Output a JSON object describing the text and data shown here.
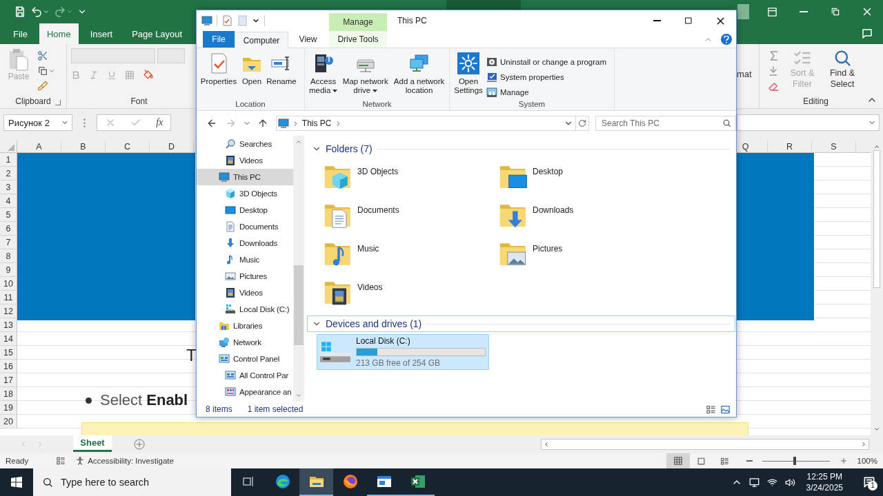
{
  "excel": {
    "tabs": [
      {
        "label": "File",
        "selected": false
      },
      {
        "label": "Home",
        "selected": true
      },
      {
        "label": "Insert",
        "selected": false
      },
      {
        "label": "Page Layout",
        "selected": false
      }
    ],
    "ribbon": {
      "paste": "Paste",
      "clipboard": "Clipboard",
      "font": "Font",
      "format_partial": "mat",
      "sort_filter": "Sort & Filter",
      "find_select": "Find & Select",
      "editing": "Editing"
    },
    "name_box": "Рисунок 2",
    "formula_label": "fx",
    "columns_left": [
      "A",
      "B",
      "C",
      "D"
    ],
    "columns_right": [
      "Q",
      "R",
      "S"
    ],
    "rows": [
      "1",
      "2",
      "3",
      "4",
      "5",
      "6",
      "7",
      "8",
      "9",
      "10",
      "11",
      "12",
      "13",
      "14",
      "15",
      "16",
      "17",
      "18",
      "19",
      "20"
    ],
    "sheet": {
      "heading": "T",
      "bullet": "Select **Enabl**"
    },
    "sheet_tabs": [
      {
        "label": "Sheet",
        "selected": true
      }
    ],
    "status": {
      "ready": "Ready",
      "accessibility": "Accessibility: Investigate",
      "zoom": "100%",
      "level": 0.48
    }
  },
  "explorer": {
    "title": "This PC",
    "context_tab": "Manage",
    "tabs": [
      {
        "label": "File",
        "kind": "file",
        "selected": false
      },
      {
        "label": "Computer",
        "kind": "tab",
        "selected": true
      },
      {
        "label": "View",
        "kind": "tab",
        "selected": false
      },
      {
        "label": "Drive Tools",
        "kind": "context",
        "selected": false
      }
    ],
    "ribbon_groups": [
      {
        "label": "Location",
        "buttons": [
          {
            "label": "Properties",
            "kind": "properties",
            "dropdown": false
          },
          {
            "label": "Open",
            "kind": "open",
            "dropdown": false
          },
          {
            "label": "Rename",
            "kind": "rename",
            "dropdown": false
          }
        ]
      },
      {
        "label": "Network",
        "buttons": [
          {
            "label": "Access media",
            "kind": "media",
            "dropdown": true
          },
          {
            "label": "Map network drive",
            "kind": "netdrive",
            "dropdown": true
          },
          {
            "label": "Add a network location",
            "kind": "netloc",
            "dropdown": false
          }
        ]
      },
      {
        "label": "System",
        "buttons": [
          {
            "label": "Open Settings",
            "kind": "settings",
            "dropdown": false
          }
        ],
        "small_buttons": [
          {
            "label": "Uninstall or change a program",
            "kind": "uninstall"
          },
          {
            "label": "System properties",
            "kind": "sysprops"
          },
          {
            "label": "Manage",
            "kind": "manage"
          }
        ]
      }
    ],
    "address": "This PC",
    "search": {
      "placeholder": "Search This PC"
    },
    "nav": [
      {
        "children": [
          {
            "label": "Searches",
            "kind": "search",
            "selected": false
          },
          {
            "label": "Videos",
            "kind": "video",
            "selected": false
          }
        ]
      },
      {
        "label": "This PC",
        "kind": "pc",
        "selected": true,
        "children": [
          {
            "label": "3D Objects",
            "kind": "cube",
            "selected": false
          },
          {
            "label": "Desktop",
            "kind": "desktop",
            "selected": false
          },
          {
            "label": "Documents",
            "kind": "document",
            "selected": false
          },
          {
            "label": "Downloads",
            "kind": "download",
            "selected": false
          },
          {
            "label": "Music",
            "kind": "music",
            "selected": false
          },
          {
            "label": "Pictures",
            "kind": "picture",
            "selected": false
          },
          {
            "label": "Videos",
            "kind": "video",
            "selected": false
          },
          {
            "label": "Local Disk (C:)",
            "kind": "drive",
            "selected": false
          }
        ]
      },
      {
        "label": "Libraries",
        "kind": "library",
        "selected": false
      },
      {
        "label": "Network",
        "kind": "network",
        "selected": false
      },
      {
        "label": "Control Panel",
        "kind": "control",
        "selected": false,
        "children": [
          {
            "label": "All Control Par",
            "kind": "control",
            "selected": false
          },
          {
            "label": "Appearance an",
            "kind": "appearance",
            "selected": false
          }
        ]
      }
    ],
    "folders_header": {
      "label": "Folders (7)",
      "expanded": true,
      "focused": false
    },
    "folders": [
      {
        "label": "3D Objects",
        "kind": "cube"
      },
      {
        "label": "Desktop",
        "kind": "desktop"
      },
      {
        "label": "Documents",
        "kind": "document"
      },
      {
        "label": "Downloads",
        "kind": "download"
      },
      {
        "label": "Music",
        "kind": "music"
      },
      {
        "label": "Pictures",
        "kind": "picture"
      },
      {
        "label": "Videos",
        "kind": "video"
      }
    ],
    "drives_header": {
      "label": "Devices and drives (1)",
      "expanded": true,
      "focused": true
    },
    "drives": [
      {
        "label": "Local Disk (C:)",
        "free": "213 GB free of 254 GB",
        "level": 0.16,
        "selected": true
      }
    ],
    "status": {
      "count": "8 items",
      "selection": "1 item selected"
    }
  },
  "taskbar": {
    "search": {
      "placeholder": "Type here to search"
    },
    "apps": [
      {
        "kind": "edge",
        "selected": false,
        "running": false
      },
      {
        "kind": "explorer",
        "selected": true,
        "running": true
      },
      {
        "kind": "firefox",
        "selected": false,
        "running": false
      },
      {
        "kind": "window",
        "selected": false,
        "running": true
      },
      {
        "kind": "excel",
        "selected": false,
        "running": true
      }
    ],
    "time": "12:25 PM",
    "date": "3/24/2025",
    "notifications": "1"
  }
}
